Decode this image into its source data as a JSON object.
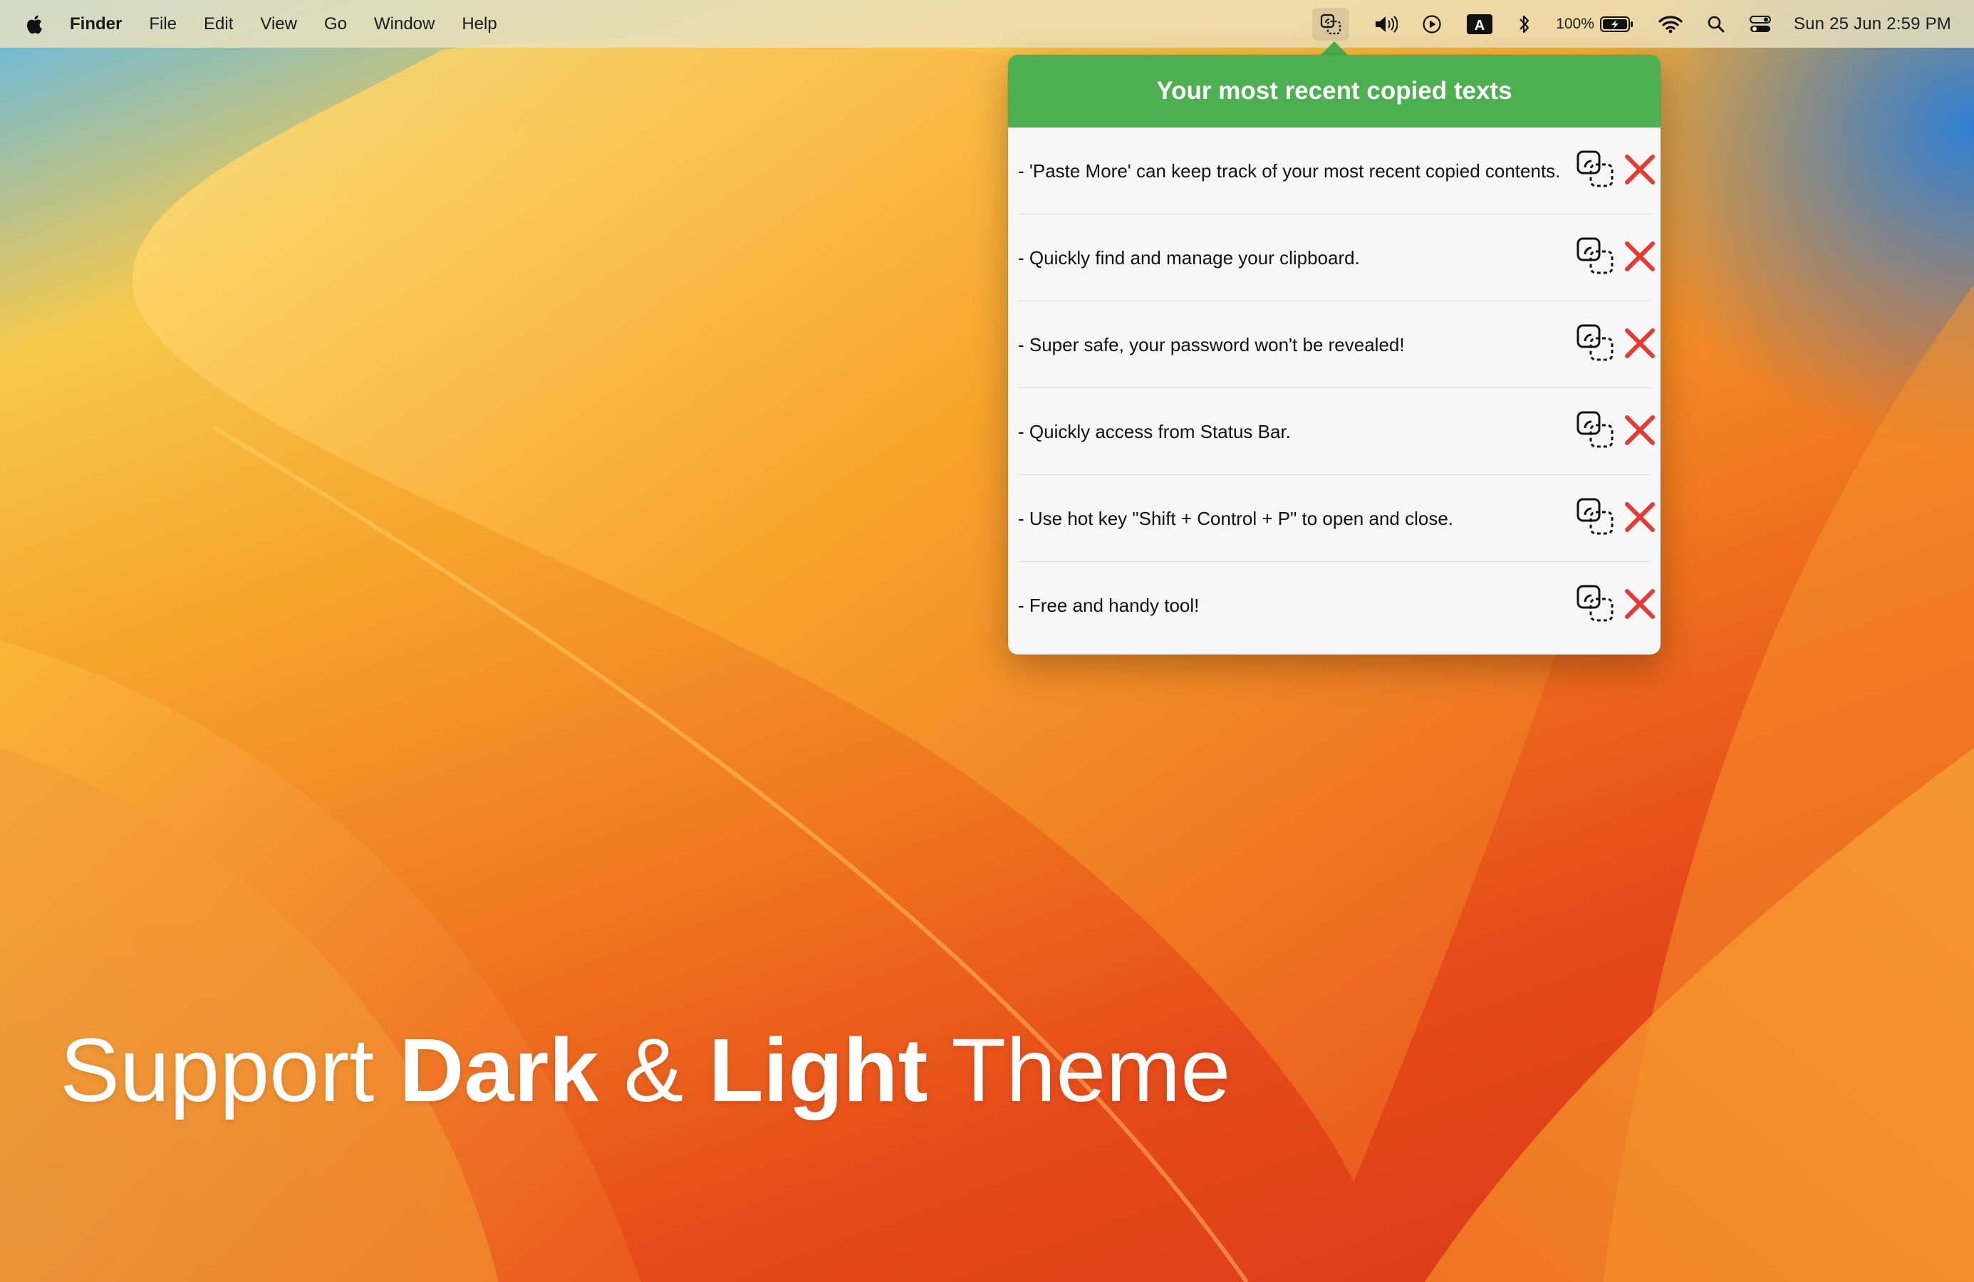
{
  "menubar": {
    "app_name": "Finder",
    "menus": [
      "File",
      "Edit",
      "View",
      "Go",
      "Window",
      "Help"
    ],
    "battery": "100%",
    "clock": "Sun 25 Jun  2:59 PM",
    "status_icons": [
      "paste-more-icon",
      "volume-icon",
      "now-playing-icon",
      "input-source-icon",
      "bluetooth-icon",
      "battery-icon",
      "wifi-icon",
      "spotlight-icon",
      "control-center-icon"
    ],
    "input_source_letter": "A"
  },
  "popover": {
    "title": "Your most recent copied texts",
    "header_color": "#4caf50",
    "items": [
      {
        "text": "- 'Paste More' can keep track of your most recent copied contents."
      },
      {
        "text": "- Quickly find and manage your clipboard."
      },
      {
        "text": "- Super safe, your password won't be revealed!"
      },
      {
        "text": "- Quickly access from Status Bar."
      },
      {
        "text": "- Use hot key \"Shift + Control + P\" to open and close."
      },
      {
        "text": "- Free and handy tool!"
      }
    ],
    "delete_color": "#e53935"
  },
  "tagline": {
    "part1": "Support ",
    "part2": "Dark",
    "part3": " & ",
    "part4": "Light",
    "part5": " Theme"
  }
}
